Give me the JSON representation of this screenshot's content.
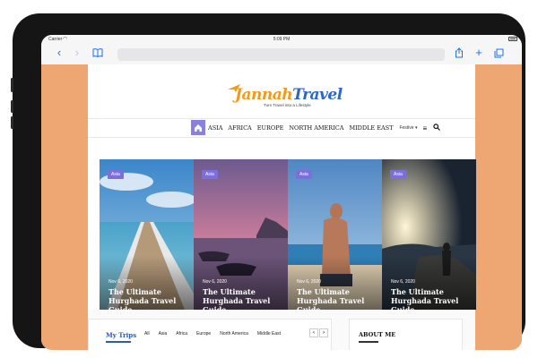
{
  "status_bar": {
    "carrier": "Carrier",
    "time": "5:09 PM"
  },
  "site": {
    "logo_part1": "Jannah",
    "logo_part2": "Travel",
    "tagline": "Turn Travel into a Lifestyle"
  },
  "nav": {
    "items": [
      "ASIA",
      "AFRICA",
      "EUROPE",
      "NORTH AMERICA",
      "MIDDLE EAST"
    ],
    "more_label": "Festive"
  },
  "slides": [
    {
      "tag": "Asia",
      "date": "Nov 6, 2020",
      "title": "The Ultimate Hurghada Travel Guide"
    },
    {
      "tag": "Asia",
      "date": "Nov 6, 2020",
      "title": "The Ultimate Hurghada Travel Guide"
    },
    {
      "tag": "Asia",
      "date": "Nov 6, 2020",
      "title": "The Ultimate Hurghada Travel Guide"
    },
    {
      "tag": "Asia",
      "date": "Nov 6, 2020",
      "title": "The Ultimate Hurghada Travel Guide"
    }
  ],
  "trips": {
    "title": "My Trips",
    "tabs": [
      "All",
      "Asia",
      "Africa",
      "Europe",
      "North America",
      "Middle East"
    ],
    "prev": "<",
    "next": ">"
  },
  "about": {
    "title": "ABOUT ME"
  },
  "colors": {
    "accent": "#7b6fdc",
    "side_bg": "#eea772",
    "link_blue": "#1a73e8",
    "logo_orange": "#f39a1b",
    "logo_blue": "#2c66c6"
  },
  "icons": [
    "back-icon",
    "forward-icon",
    "bookmarks-icon",
    "share-icon",
    "new-tab-icon",
    "tabs-icon",
    "home-icon",
    "menu-icon",
    "search-icon"
  ]
}
